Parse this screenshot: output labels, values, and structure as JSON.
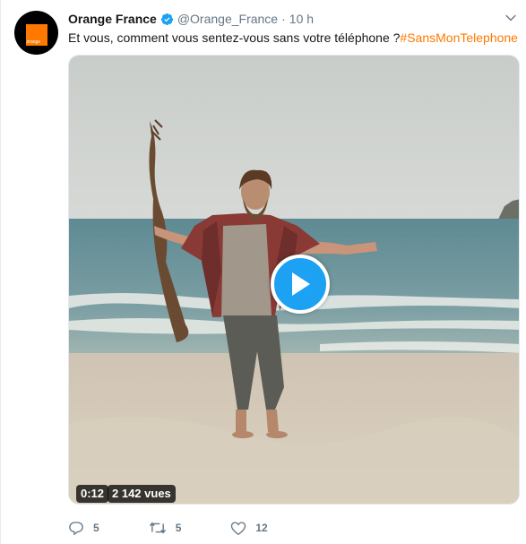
{
  "tweet": {
    "author_name": "Orange France",
    "handle": "@Orange_France",
    "separator": "·",
    "time": "10 h",
    "text_plain": "Et vous, comment vous sentez-vous sans votre téléphone ?",
    "hashtag": "#SansMonTelephone",
    "avatar_logo_text": "orange",
    "brand_color": "#ff7900",
    "verified_color": "#1da1f2"
  },
  "video": {
    "duration": "0:12",
    "views": "2 142 vues",
    "play_color": "#1da1f2"
  },
  "actions": {
    "replies": "5",
    "retweets": "5",
    "likes": "12"
  },
  "icons": [
    "verified-icon",
    "chevron-down-icon",
    "play-icon",
    "reply-icon",
    "retweet-icon",
    "like-icon"
  ]
}
